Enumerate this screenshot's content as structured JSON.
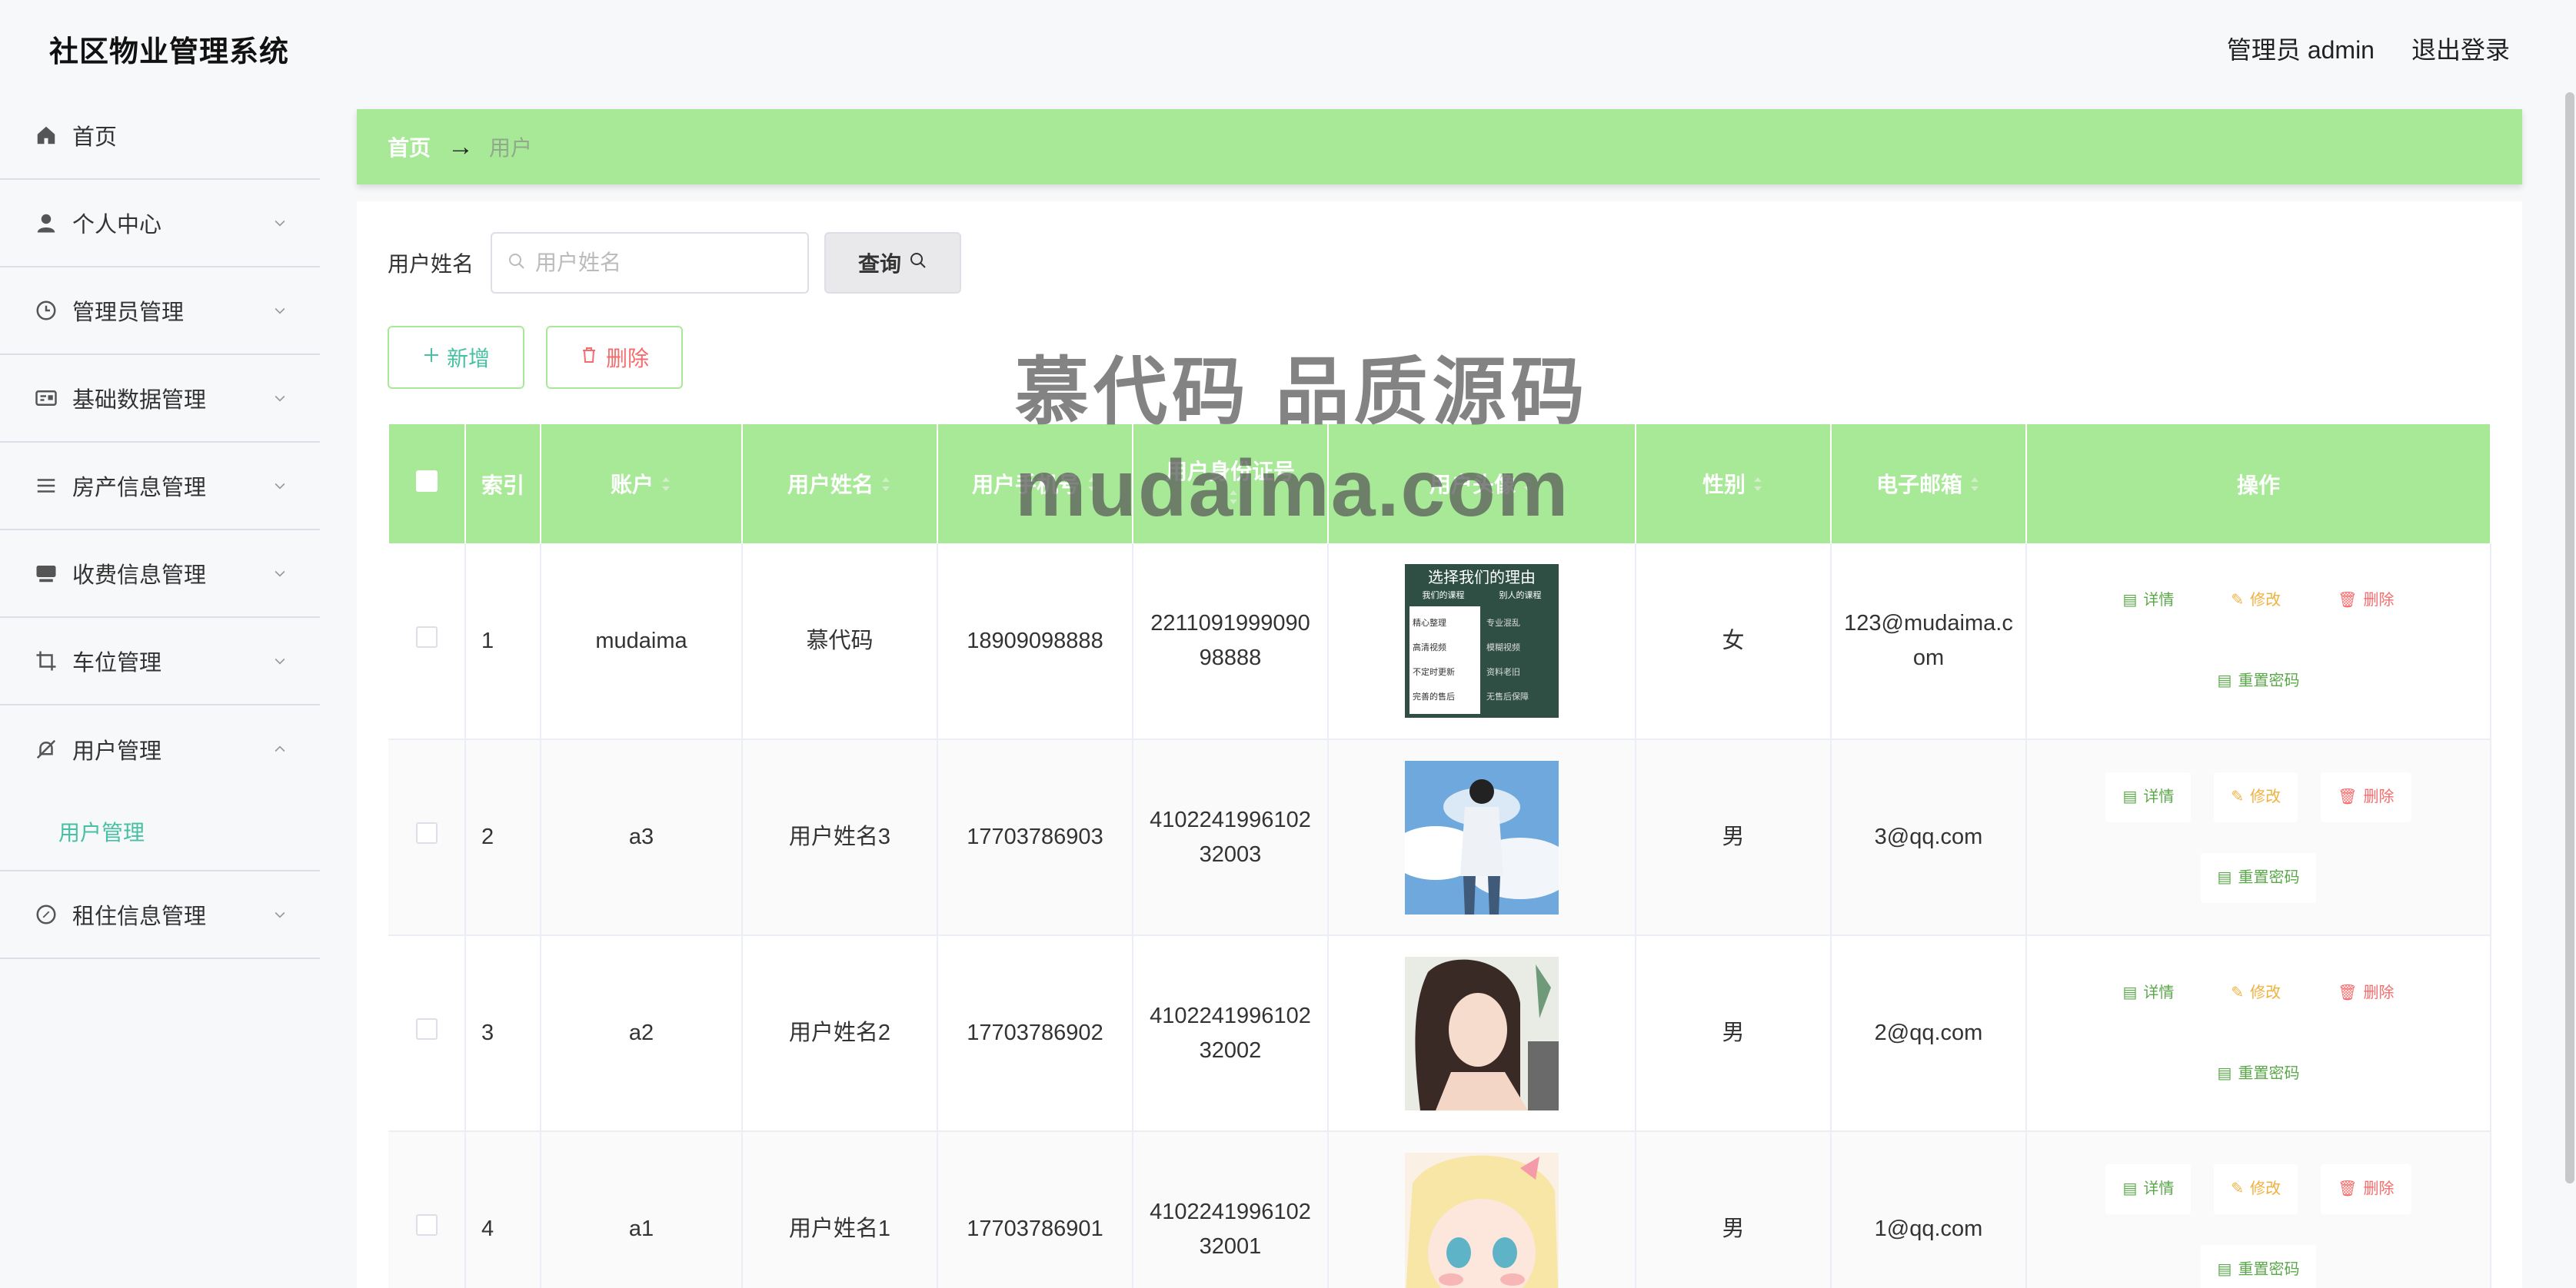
{
  "header": {
    "title": "社区物业管理系统",
    "admin_label": "管理员 admin",
    "logout_label": "退出登录"
  },
  "sidebar": {
    "items": [
      {
        "label": "首页",
        "icon": "home-icon"
      },
      {
        "label": "个人中心",
        "icon": "user-icon"
      },
      {
        "label": "管理员管理",
        "icon": "clock-icon"
      },
      {
        "label": "基础数据管理",
        "icon": "id-card-icon"
      },
      {
        "label": "房产信息管理",
        "icon": "list-icon"
      },
      {
        "label": "收费信息管理",
        "icon": "cash-icon"
      },
      {
        "label": "车位管理",
        "icon": "crop-icon"
      },
      {
        "label": "用户管理",
        "icon": "bell-off-icon"
      },
      {
        "label": "租住信息管理",
        "icon": "compass-icon"
      }
    ],
    "submenu_active": "用户管理"
  },
  "breadcrumb": {
    "home": "首页",
    "arrow": "→",
    "current": "用户"
  },
  "search": {
    "label": "用户姓名",
    "placeholder": "用户姓名",
    "value": "",
    "query_label": "查询"
  },
  "actions": {
    "add_label": "新增",
    "delete_label": "删除"
  },
  "table": {
    "headers": {
      "index": "索引",
      "account": "账户",
      "name": "用户姓名",
      "phone": "用户手机号",
      "id_number": "用户身份证号",
      "avatar": "用户头像",
      "gender": "性别",
      "email": "电子邮箱",
      "ops": "操作"
    },
    "rows": [
      {
        "index": "1",
        "account": "mudaima",
        "name": "慕代码",
        "phone": "18909098888",
        "id_number": "221109199909098888",
        "gender": "女",
        "email": "123@mudaima.com"
      },
      {
        "index": "2",
        "account": "a3",
        "name": "用户姓名3",
        "phone": "17703786903",
        "id_number": "410224199610232003",
        "gender": "男",
        "email": "3@qq.com"
      },
      {
        "index": "3",
        "account": "a2",
        "name": "用户姓名2",
        "phone": "17703786902",
        "id_number": "410224199610232002",
        "gender": "男",
        "email": "2@qq.com"
      },
      {
        "index": "4",
        "account": "a1",
        "name": "用户姓名1",
        "phone": "17703786901",
        "id_number": "410224199610232001",
        "gender": "男",
        "email": "1@qq.com"
      }
    ],
    "op_labels": {
      "detail": "详情",
      "edit": "修改",
      "remove": "删除",
      "reset": "重置密码"
    },
    "avatar1_text": {
      "title": "选择我们的理由",
      "left_head": "我们的课程",
      "right_head": "别人的课程",
      "left": [
        "精心整理",
        "高清视频",
        "不定时更新",
        "完善的售后"
      ],
      "right": [
        "专业混乱",
        "模糊视频",
        "资料老旧",
        "无售后保障"
      ]
    }
  },
  "watermark": {
    "line1": "慕代码 品质源码",
    "line2": "mudaima.com"
  },
  "colors": {
    "accent_green": "#a8e998",
    "teal_text": "#48c0a3",
    "danger": "#f56c6c",
    "warning": "#f1b13f"
  }
}
